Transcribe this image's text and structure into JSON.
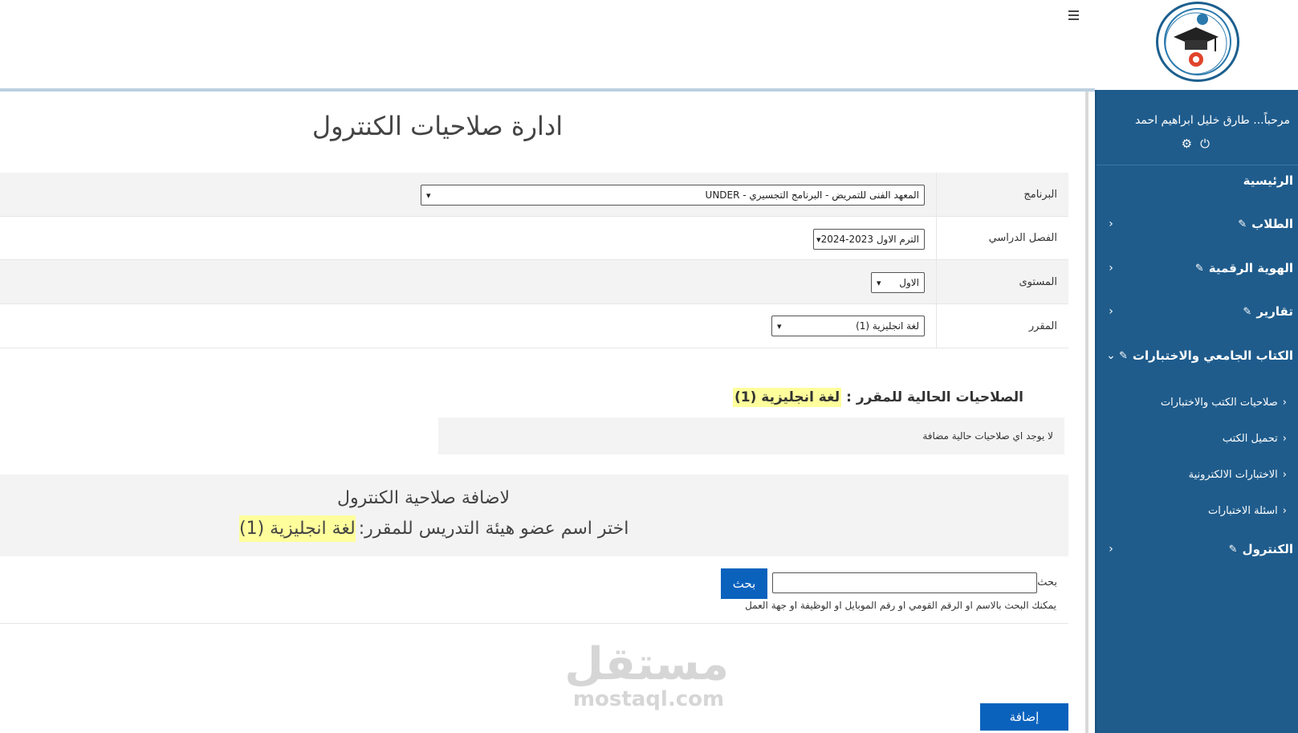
{
  "header": {
    "logo_icon": "university-logo-icon",
    "menu_icon": "hamburger-menu-icon"
  },
  "sidebar": {
    "welcome": "مرحباً... طارق خليل ابراهيم احمد",
    "icons": [
      "settings-gear-icon",
      "power-icon"
    ],
    "items": [
      {
        "label": "الرئيسية",
        "has_chevron": false
      },
      {
        "label": "الطلاب",
        "has_chevron": true
      },
      {
        "label": "الهوية الرقمية",
        "has_chevron": true
      },
      {
        "label": "تقارير",
        "has_chevron": true
      },
      {
        "label": "الكتاب الجامعي والاختبارات",
        "has_chevron": true,
        "expanded": true
      },
      {
        "label": "الكنترول",
        "has_chevron": true
      }
    ],
    "subitems": [
      {
        "label": "صلاحيات الكتب والاختبارات"
      },
      {
        "label": "تحميل الكتب"
      },
      {
        "label": "الاختبارات الالكترونية"
      },
      {
        "label": "اسئلة الاختبارات"
      }
    ],
    "bg_color": "#1f5c8c"
  },
  "page": {
    "title": "ادارة صلاحيات الكنترول"
  },
  "form": {
    "program": {
      "label": "البرنامج",
      "value": "المعهد الفنى للتمريض - البرنامج التجسيري - UNDER"
    },
    "semester": {
      "label": "الفصل الدراسي",
      "value": "الترم الاول 2023-2024"
    },
    "level": {
      "label": "المستوى",
      "value": "الاول"
    },
    "course": {
      "label": "المقرر",
      "value": "لغة انجليزية (1)"
    }
  },
  "permissions": {
    "title_prefix": "الصلاحيات الحالية  للمقرر :",
    "course": "لغة انجليزية (1)",
    "empty_message": "لا يوجد اي صلاحيات حالية مضافة"
  },
  "add_panel": {
    "line1": "لاضافة صلاحية الكنترول",
    "line2_prefix": "اختر اسم عضو هيئة التدريس للمقرر:",
    "course": "لغة انجليزية (1)"
  },
  "search": {
    "label": "بحث",
    "placeholder": "",
    "button_label": "بحث",
    "hint": "يمكنك البحث بالاسم او الرقم القومي او رقم الموبايل او الوظيفة او جهة العمل"
  },
  "watermark": {
    "arabic": "مستقل",
    "latin": "mostaql.com"
  },
  "actions": {
    "add_label": "إضافة"
  },
  "colors": {
    "primary_button": "#0a62bd",
    "highlight": "#fefe9c",
    "panel_bg": "#f3f3f3"
  }
}
